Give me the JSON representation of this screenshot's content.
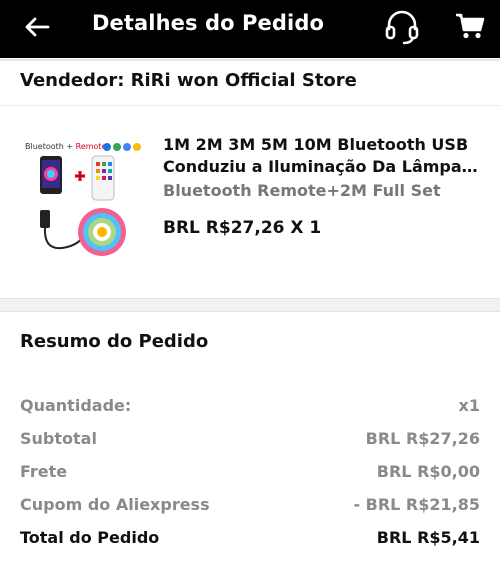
{
  "header": {
    "title": "Detalhes do Pedido",
    "icons": {
      "back": "back-arrow-icon",
      "support": "headset-icon",
      "cart": "shopping-cart-icon"
    }
  },
  "seller": {
    "label": "Vendedor: RiRi won Official Store"
  },
  "product": {
    "image_label_prefix": "Bluetooth + ",
    "image_label_suffix": "Remote",
    "title_line1": "1M 2M 3M 5M 10M Bluetooth USB",
    "title_line2": "Conduziu a Iluminação Da Lâmpada LED…",
    "variant": "Bluetooth Remote+2M Full Set",
    "price_qty": "BRL R$27,26 X 1"
  },
  "summary": {
    "title": "Resumo do Pedido",
    "rows": [
      {
        "label": "Quantidade:",
        "value": "x1"
      },
      {
        "label": "Subtotal",
        "value": "BRL R$27,26"
      },
      {
        "label": "Frete",
        "value": "BRL R$0,00"
      },
      {
        "label": "Cupom do Aliexpress",
        "value": "- BRL R$21,85"
      }
    ],
    "total": {
      "label": "Total do Pedido",
      "value": "BRL R$5,41"
    }
  },
  "colors": {
    "header_bg": "#000000",
    "muted_text": "#8a8a8a",
    "accent_red": "#d0021b"
  }
}
